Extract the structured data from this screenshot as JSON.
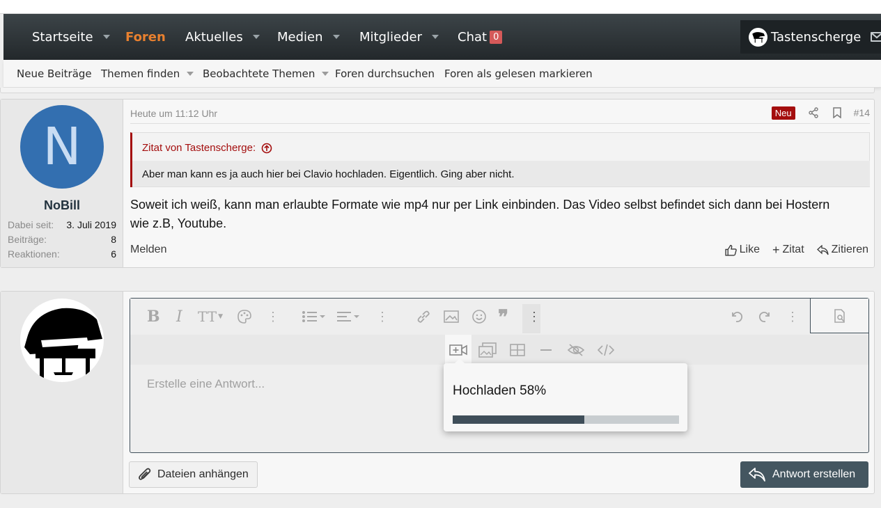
{
  "nav": {
    "items": [
      {
        "label": "Startseite"
      },
      {
        "label": "Foren"
      },
      {
        "label": "Aktuelles"
      },
      {
        "label": "Medien"
      },
      {
        "label": "Mitglieder"
      },
      {
        "label": "Chat"
      }
    ],
    "chat_badge": "0",
    "user_name": "Tastenscherge"
  },
  "subnav": {
    "items": [
      {
        "label": "Neue Beiträge"
      },
      {
        "label": "Themen finden"
      },
      {
        "label": "Beobachtete Themen"
      },
      {
        "label": "Foren durchsuchen"
      },
      {
        "label": "Foren als gelesen markieren"
      }
    ]
  },
  "post": {
    "avatar_letter": "N",
    "username": "NoBill",
    "stats": [
      {
        "key": "Dabei seit:",
        "value": "3. Juli 2019"
      },
      {
        "key": "Beiträge:",
        "value": "8"
      },
      {
        "key": "Reaktionen:",
        "value": "6"
      }
    ],
    "date": "Heute um 11:12 Uhr",
    "new_badge": "Neu",
    "number": "#14",
    "quote_author": "Zitat von Tastenscherge:",
    "quote_text": "Aber man kann es ja auch hier bei Clavio hochladen. Eigentlich. Ging aber nicht.",
    "text_line1": "Soweit ich weiß, kann man erlaubte Formate wie mp4 nur per Link einbinden. Das Video selbst befindet sich dann bei Hostern",
    "text_line2": "wie z.B, Youtube.",
    "report": "Melden",
    "like": "Like",
    "zitat": "Zitat",
    "zitieren": "Zitieren"
  },
  "editor": {
    "placeholder": "Erstelle eine Antwort..."
  },
  "upload": {
    "label": "Hochladen 58%",
    "progress_percent": 58
  },
  "buttons": {
    "attach": "Dateien anhängen",
    "submit": "Antwort erstellen"
  },
  "colors": {
    "accent": "#e8802f",
    "quote": "#a40e0e",
    "avatar_blue": "#336fb0",
    "button_dark": "#445660"
  }
}
